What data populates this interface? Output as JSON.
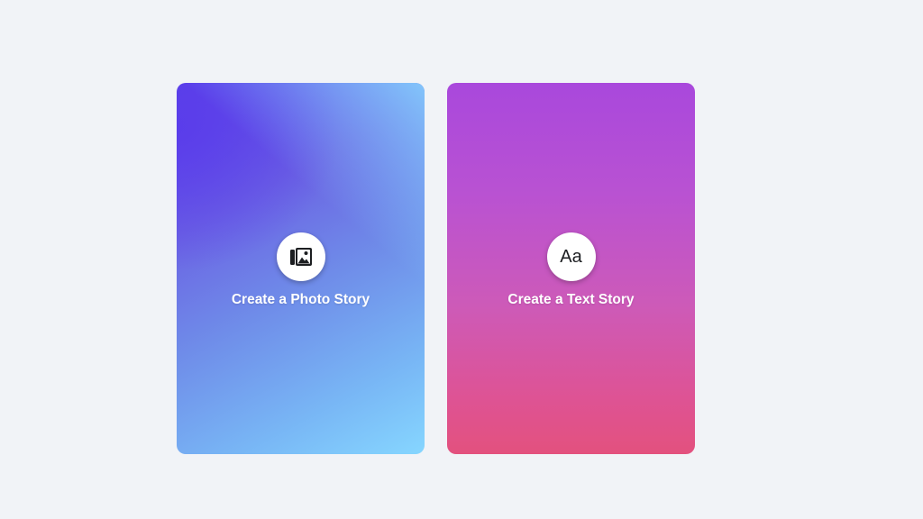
{
  "story_options": {
    "photo": {
      "label": "Create a Photo Story",
      "icon": "photo-gallery-icon"
    },
    "text": {
      "label": "Create a Text Story",
      "icon": "text-aa-icon",
      "icon_glyph": "Aa"
    }
  },
  "colors": {
    "background": "#f1f3f7",
    "photo_gradient": [
      "#5b3fe9",
      "#86d6ff"
    ],
    "text_gradient": [
      "#a948dc",
      "#e3517e"
    ],
    "label": "#ffffff",
    "icon_circle": "#ffffff"
  }
}
